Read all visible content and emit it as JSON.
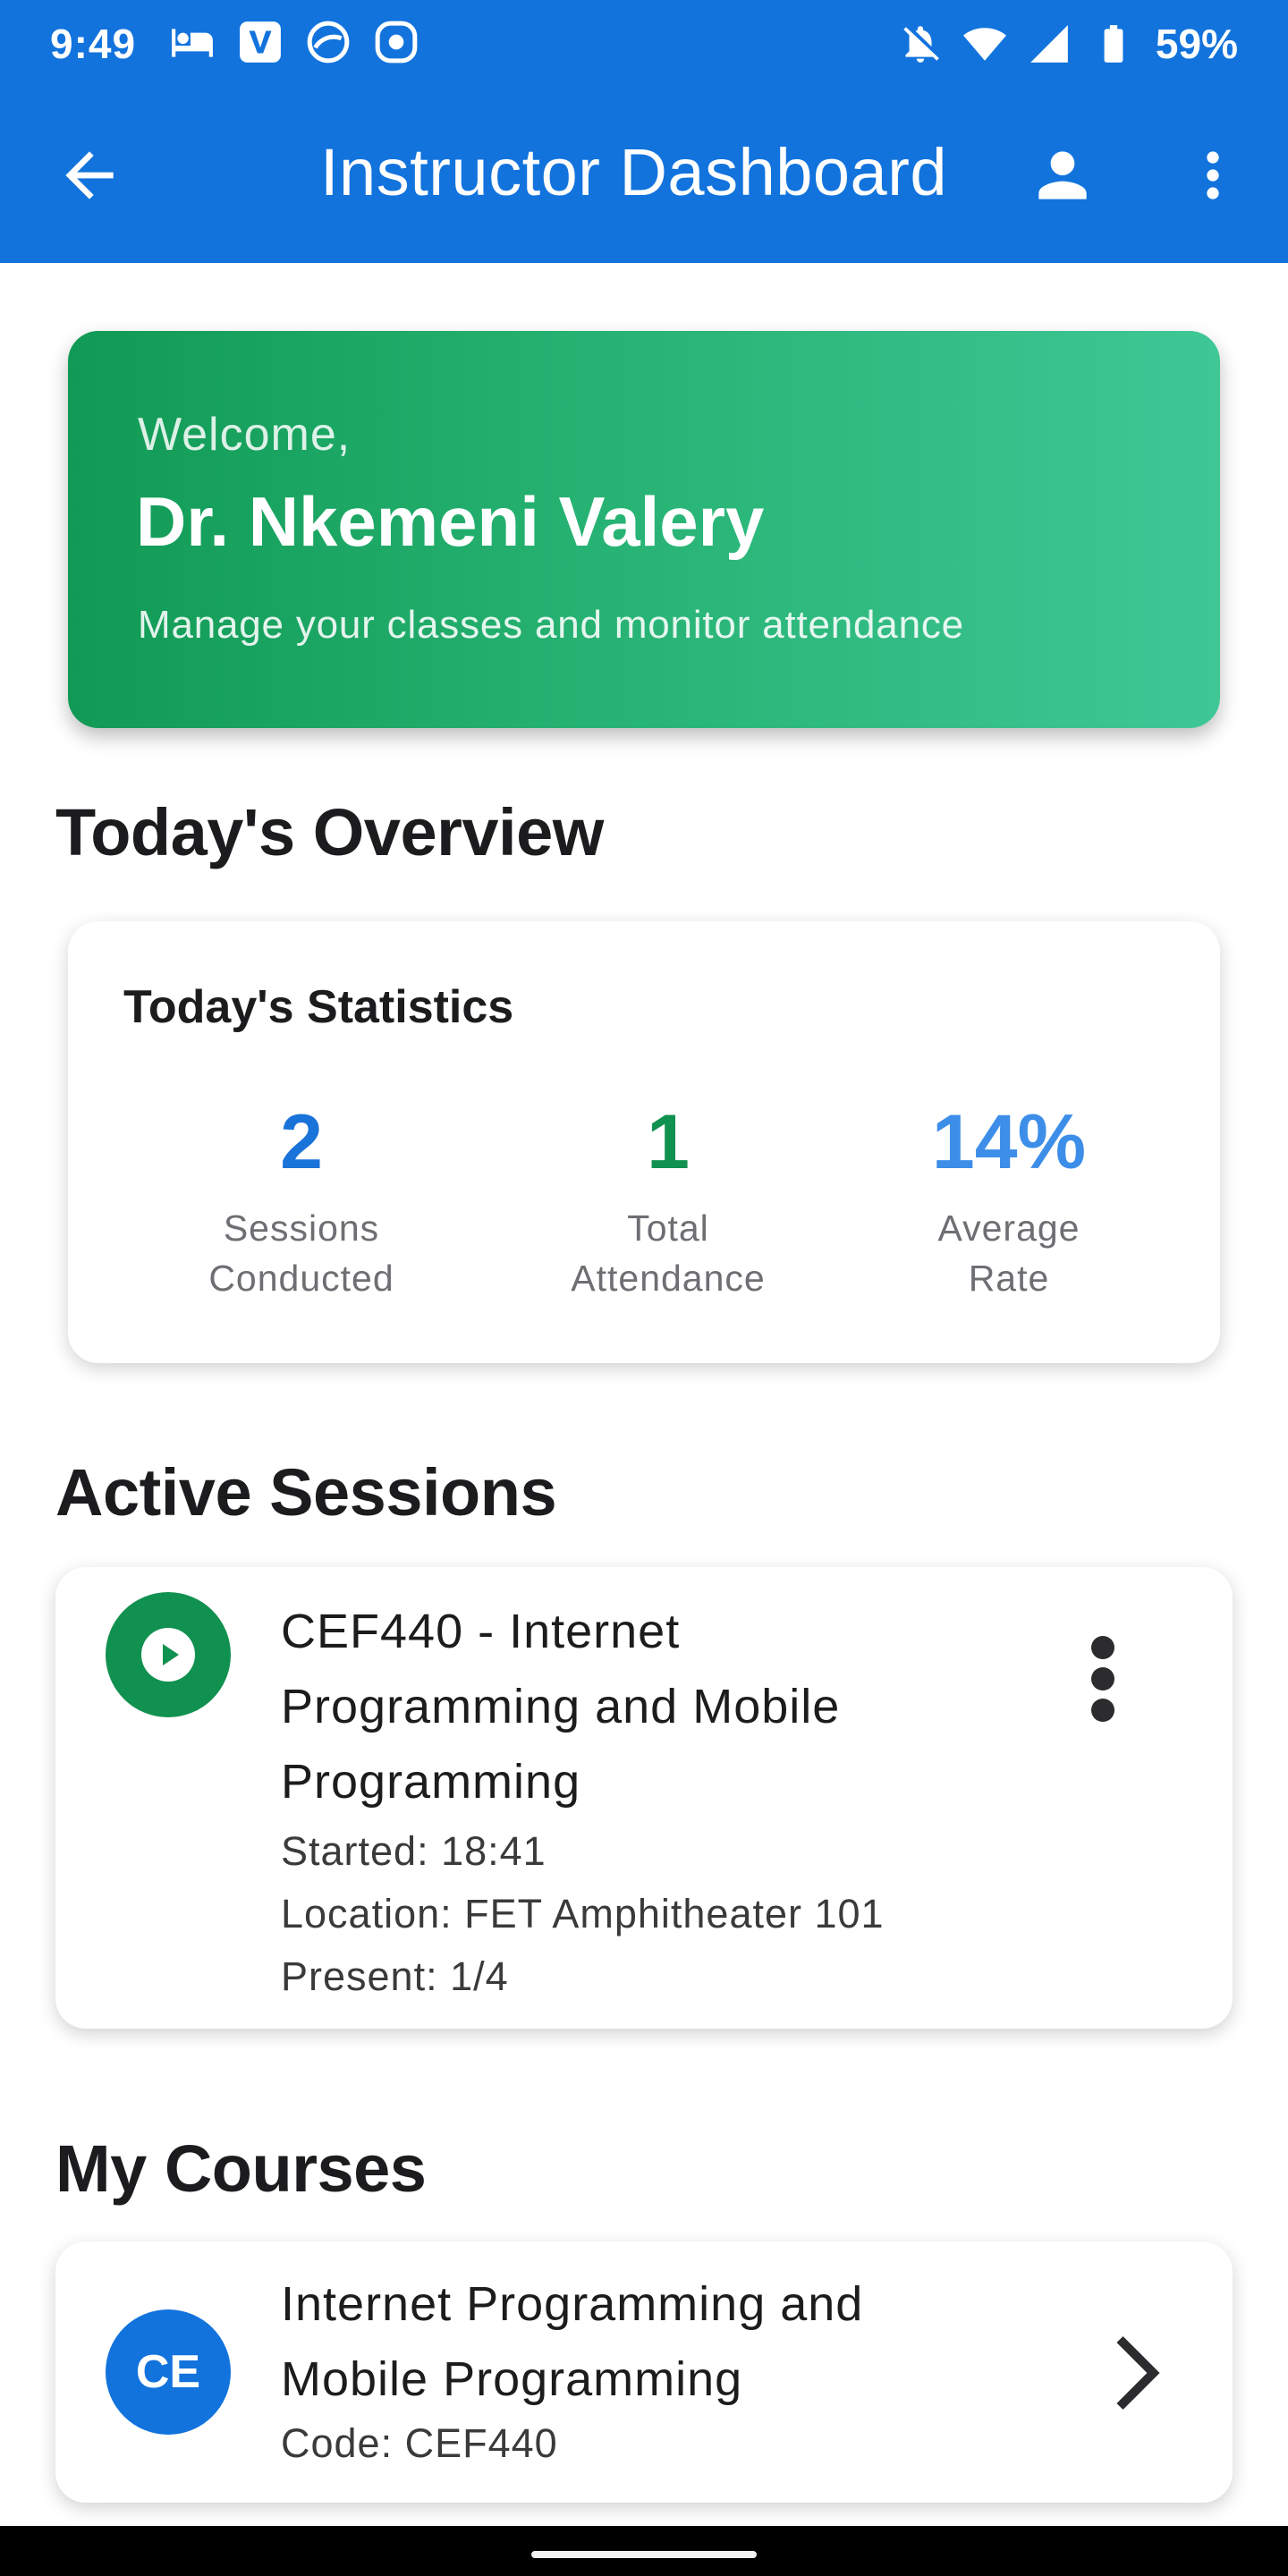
{
  "status_bar": {
    "time": "9:49",
    "battery": "59%",
    "left_icons": [
      "hotel-icon",
      "v-app-icon",
      "app-icon",
      "record-icon"
    ],
    "right_icons": [
      "bell-off-icon",
      "wifi-icon",
      "signal-icon",
      "battery-icon"
    ]
  },
  "app_bar": {
    "title": "Instructor Dashboard",
    "color": "#1273dd"
  },
  "welcome": {
    "greeting": "Welcome,",
    "name": "Dr. Nkemeni Valery",
    "subtitle": "Manage your classes and monitor attendance"
  },
  "overview": {
    "section_title": "Today's Overview",
    "card_title": "Today's Statistics",
    "stats": [
      {
        "value": "2",
        "label": "Sessions\nConducted",
        "color": "#1a73d9"
      },
      {
        "value": "1",
        "label": "Total\nAttendance",
        "color": "#11914f"
      },
      {
        "value": "14%",
        "label": "Average\nRate",
        "color": "#3d8ee8"
      }
    ]
  },
  "active_sessions": {
    "section_title": "Active Sessions",
    "items": [
      {
        "title": "CEF440 - Internet Programming and Mobile Programming",
        "started": "Started: 18:41",
        "location": "Location: FET Amphitheater 101",
        "present": "Present: 1/4"
      }
    ]
  },
  "courses": {
    "section_title": "My Courses",
    "items": [
      {
        "avatar": "CE",
        "title": "Internet Programming and Mobile Programming",
        "code": "Code: CEF440"
      }
    ]
  }
}
